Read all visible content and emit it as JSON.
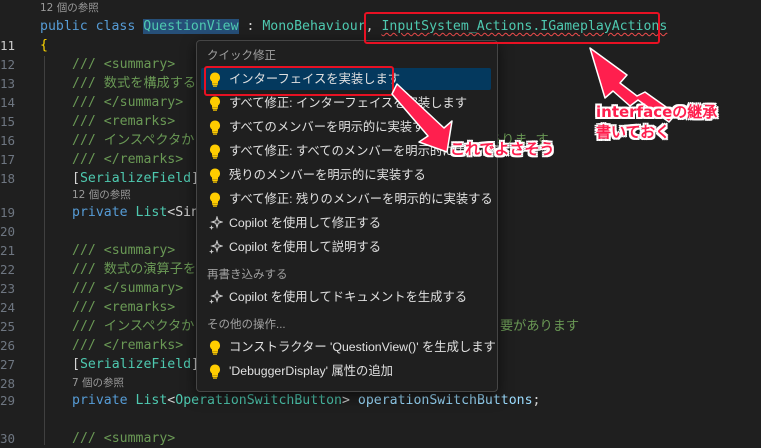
{
  "editor": {
    "line_numbers": [
      "11",
      "12",
      "13",
      "14",
      "15",
      "16",
      "17",
      "18",
      "19",
      "20",
      "21",
      "22",
      "23",
      "24",
      "25",
      "26",
      "27",
      "28",
      "29",
      "30"
    ],
    "active_line": "11",
    "code_lens": {
      "top": "12 個の参照",
      "line19": "12 個の参照",
      "line28": "7 個の参照"
    },
    "lines": {
      "l11": {
        "kw1": "public",
        "kw2": "class",
        "name": "QuestionView",
        "sep": " : ",
        "base": "MonoBehaviour",
        "comma": ", ",
        "iface": "InputSystem_Actions.IGameplayActions"
      },
      "l12": "{",
      "l13": "/// <summary>",
      "l14": "/// 数式を構成する",
      "l15": "/// </summary>",
      "l16": "/// <remarks>",
      "l17": "/// インスペクタか",
      "l17b": "ありま す",
      "l18": "/// </remarks>",
      "l19a": "[",
      "l19b": "SerializeField",
      "l19c": "]",
      "l20kw": "private",
      "l20ty": "List",
      "l20rest": "<Sin",
      "l22": "/// <summary>",
      "l23": "/// 数式の演算子を",
      "l24": "/// </summary>",
      "l25": "/// <remarks>",
      "l26": "/// インスペクタか",
      "l26b": "要があります",
      "l27": "/// </remarks>",
      "l28a": "[",
      "l28b": "SerializeField",
      "l28c": "]",
      "l29kw": "private",
      "l29ty": "List",
      "l29lt": "<",
      "l29ty2": "OperationSwitchButton",
      "l29gt": "> ",
      "l29var": "operationSwitchButtons",
      "l29end": ";",
      "l30": "/// <summary>"
    }
  },
  "quick_fix": {
    "header_quick": "クイック修正",
    "header_rewrite": "再書き込みする",
    "header_other": "その他の操作...",
    "items": [
      {
        "label": "インターフェイスを実装します",
        "icon": "lightbulb-icon",
        "selected": true
      },
      {
        "label": "すべて修正: インターフェイスを実装します",
        "icon": "lightbulb-icon"
      },
      {
        "label": "すべてのメンバーを明示的に実装する",
        "icon": "lightbulb-icon"
      },
      {
        "label": "すべて修正: すべてのメンバーを明示的に実装する",
        "icon": "lightbulb-icon"
      },
      {
        "label": "残りのメンバーを明示的に実装する",
        "icon": "lightbulb-icon"
      },
      {
        "label": "すべて修正: 残りのメンバーを明示的に実装する",
        "icon": "lightbulb-icon"
      },
      {
        "label": "Copilot を使用して修正する",
        "icon": "sparkle-icon"
      },
      {
        "label": "Copilot を使用して説明する",
        "icon": "sparkle-icon"
      },
      {
        "label": "Copilot を使用してドキュメントを生成する",
        "icon": "sparkle-icon"
      },
      {
        "label": "コンストラクター 'QuestionView()' を生成します",
        "icon": "lightbulb-icon"
      },
      {
        "label": "'DebuggerDisplay' 属性の追加",
        "icon": "lightbulb-icon"
      }
    ]
  },
  "annotations": {
    "interface_note_line1": "interfaceの継承",
    "interface_note_line2": "書いておく",
    "choice_note": "これでよさそう",
    "color": "#ff1f4e"
  }
}
